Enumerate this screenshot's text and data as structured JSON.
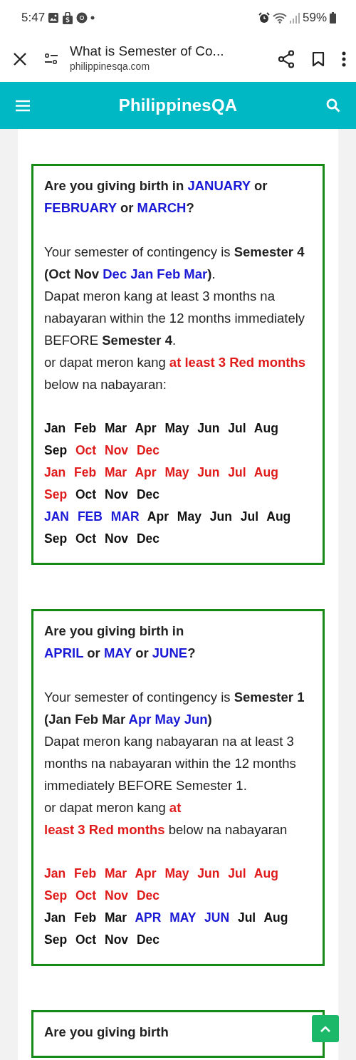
{
  "status_bar": {
    "time": "5:47",
    "battery": "59%"
  },
  "browser": {
    "title": "What is Semester of Co...",
    "url": "philippinesqa.com"
  },
  "site": {
    "title": "PhilippinesQA"
  },
  "sections": [
    {
      "question": [
        [
          {
            "text": "Are you giving birth in "
          },
          {
            "text": "JANUARY",
            "color": "#1a1ad6"
          },
          {
            "text": " or "
          },
          {
            "text": "FEBRUARY",
            "color": "#1a1ad6"
          },
          {
            "text": " or "
          },
          {
            "text": "MARCH",
            "color": "#1a1ad6"
          },
          {
            "text": "?"
          }
        ]
      ],
      "text": [
        [
          {
            "text": "Your semester of contingency is ",
            "bold": false
          },
          {
            "text": "Semester 4 (Oct Nov ",
            "bold": true
          },
          {
            "text": "Dec Jan Feb Mar",
            "color": "#1a1ad6",
            "bold": true
          },
          {
            "text": ")",
            "bold": true
          },
          {
            "text": ".",
            "bold": false
          }
        ],
        [
          {
            "text": "Dapat meron kang at least 3 months na nabayaran within the 12 months immediately BEFORE ",
            "bold": false
          },
          {
            "text": "Semester 4",
            "bold": true
          },
          {
            "text": ".",
            "bold": false
          }
        ],
        [
          {
            "text": "or dapat meron kang ",
            "bold": false
          },
          {
            "text": "at least 3 Red months",
            "color": "#e01b1b",
            "bold": true
          },
          {
            "text": " below na nabayaran:",
            "bold": false
          }
        ]
      ],
      "months": [
        [
          {
            "text": "Jan",
            "color": "#111111"
          },
          {
            "text": "Feb",
            "color": "#111111"
          },
          {
            "text": "Mar",
            "color": "#111111"
          },
          {
            "text": "Apr",
            "color": "#111111"
          },
          {
            "text": "May",
            "color": "#111111"
          },
          {
            "text": "Jun",
            "color": "#111111"
          },
          {
            "text": "Jul",
            "color": "#111111"
          },
          {
            "text": "Aug",
            "color": "#111111"
          },
          {
            "text": "Sep",
            "color": "#111111"
          },
          {
            "text": "Oct",
            "color": "#e01b1b"
          },
          {
            "text": "Nov",
            "color": "#e01b1b"
          },
          {
            "text": "Dec",
            "color": "#e01b1b"
          }
        ],
        [
          {
            "text": "Jan",
            "color": "#e01b1b"
          },
          {
            "text": "Feb",
            "color": "#e01b1b"
          },
          {
            "text": "Mar",
            "color": "#e01b1b"
          },
          {
            "text": "Apr",
            "color": "#e01b1b"
          },
          {
            "text": "May",
            "color": "#e01b1b"
          },
          {
            "text": "Jun",
            "color": "#e01b1b"
          },
          {
            "text": "Jul",
            "color": "#e01b1b"
          },
          {
            "text": "Aug",
            "color": "#e01b1b"
          },
          {
            "text": "Sep",
            "color": "#e01b1b"
          },
          {
            "text": "Oct",
            "color": "#111111"
          },
          {
            "text": "Nov",
            "color": "#111111"
          },
          {
            "text": "Dec",
            "color": "#111111"
          }
        ],
        [
          {
            "text": "JAN",
            "color": "#1a1ad6"
          },
          {
            "text": "FEB",
            "color": "#1a1ad6"
          },
          {
            "text": "MAR",
            "color": "#1a1ad6"
          },
          {
            "text": "Apr",
            "color": "#111111"
          },
          {
            "text": "May",
            "color": "#111111"
          },
          {
            "text": "Jun",
            "color": "#111111"
          },
          {
            "text": "Jul",
            "color": "#111111"
          },
          {
            "text": "Aug",
            "color": "#111111"
          },
          {
            "text": "Sep",
            "color": "#111111"
          },
          {
            "text": "Oct",
            "color": "#111111"
          },
          {
            "text": "Nov",
            "color": "#111111"
          },
          {
            "text": "Dec",
            "color": "#111111"
          }
        ]
      ]
    },
    {
      "question": [
        [
          {
            "text": "Are you giving birth in"
          }
        ],
        [
          {
            "text": "APRIL",
            "color": "#1a1ad6"
          },
          {
            "text": " or "
          },
          {
            "text": "MAY",
            "color": "#1a1ad6"
          },
          {
            "text": " or "
          },
          {
            "text": "JUNE",
            "color": "#1a1ad6"
          },
          {
            "text": "?"
          }
        ]
      ],
      "text": [
        [
          {
            "text": "Your semester of contingency is ",
            "bold": false
          },
          {
            "text": "Semester 1 (Jan Feb Mar ",
            "bold": true
          },
          {
            "text": "Apr May Jun",
            "color": "#1a1ad6",
            "bold": true
          },
          {
            "text": ")",
            "bold": true
          }
        ],
        [
          {
            "text": "Dapat meron kang nabayaran na at least 3 months na nabayaran within the 12 months immediately BEFORE Semester 1.",
            "bold": false
          }
        ],
        [
          {
            "text": "or dapat meron kang ",
            "bold": false
          },
          {
            "text": "at",
            "color": "#e01b1b",
            "bold": true
          }
        ],
        [
          {
            "text": "least 3 Red months",
            "color": "#e01b1b",
            "bold": true
          },
          {
            "text": " below na nabayaran",
            "bold": false
          }
        ]
      ],
      "months": [
        [
          {
            "text": "Jan",
            "color": "#e01b1b"
          },
          {
            "text": "Feb",
            "color": "#e01b1b"
          },
          {
            "text": "Mar",
            "color": "#e01b1b"
          },
          {
            "text": "Apr",
            "color": "#e01b1b"
          },
          {
            "text": "May",
            "color": "#e01b1b"
          },
          {
            "text": "Jun",
            "color": "#e01b1b"
          },
          {
            "text": "Jul",
            "color": "#e01b1b"
          },
          {
            "text": "Aug",
            "color": "#e01b1b"
          },
          {
            "text": "Sep",
            "color": "#e01b1b"
          },
          {
            "text": "Oct",
            "color": "#e01b1b"
          },
          {
            "text": "Nov",
            "color": "#e01b1b"
          },
          {
            "text": "Dec",
            "color": "#e01b1b"
          }
        ],
        [
          {
            "text": "Jan",
            "color": "#111111"
          },
          {
            "text": "Feb",
            "color": "#111111"
          },
          {
            "text": "Mar",
            "color": "#111111"
          },
          {
            "text": "APR",
            "color": "#1a1ad6"
          },
          {
            "text": "MAY",
            "color": "#1a1ad6"
          },
          {
            "text": "JUN",
            "color": "#1a1ad6"
          },
          {
            "text": "Jul",
            "color": "#111111"
          },
          {
            "text": "Aug",
            "color": "#111111"
          },
          {
            "text": "Sep",
            "color": "#111111"
          },
          {
            "text": "Oct",
            "color": "#111111"
          },
          {
            "text": "Nov",
            "color": "#111111"
          },
          {
            "text": "Dec",
            "color": "#111111"
          }
        ]
      ]
    },
    {
      "question": [
        [
          {
            "text": "Are you giving birth"
          }
        ]
      ]
    }
  ]
}
